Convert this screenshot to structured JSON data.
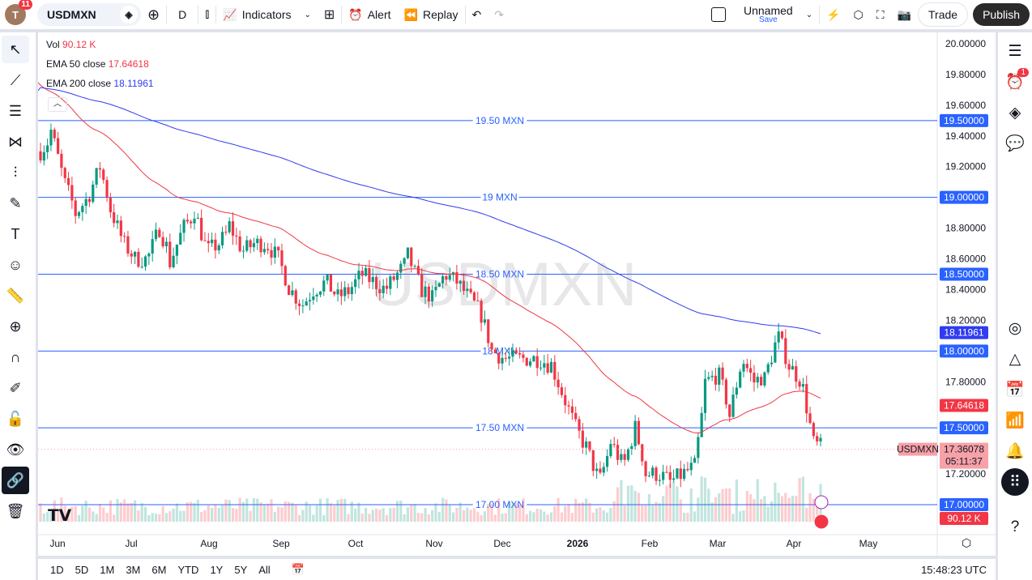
{
  "toolbar": {
    "avatar_letter": "T",
    "notif": "11",
    "symbol": "USDMXN",
    "interval": "D",
    "indicators": "Indicators",
    "alert": "Alert",
    "replay": "Replay",
    "layout_name": "Unnamed",
    "save": "Save",
    "trade": "Trade",
    "publish": "Publish"
  },
  "legend": {
    "vol_label": "Vol",
    "vol_value": "90.12 K",
    "ema50_label": "EMA 50 close",
    "ema50_value": "17.64618",
    "ema200_label": "EMA 200 close",
    "ema200_value": "18.11961"
  },
  "watermark": "USDMXN",
  "price_axis": [
    "20.00000",
    "19.80000",
    "19.60000",
    "19.40000",
    "19.20000",
    "18.80000",
    "18.60000",
    "18.40000",
    "18.20000",
    "17.80000",
    "17.20000"
  ],
  "hlines": [
    {
      "label": "19.50 MXN",
      "price": 19.5,
      "tag": "19.50000"
    },
    {
      "label": "19 MXN",
      "price": 19.0,
      "tag": "19.00000"
    },
    {
      "label": "18.50 MXN",
      "price": 18.5,
      "tag": "18.50000"
    },
    {
      "label": "18 MXN",
      "price": 18.0,
      "tag": "18.00000"
    },
    {
      "label": "17.50 MXN",
      "price": 17.5,
      "tag": "17.50000"
    },
    {
      "label": "17.00 MXN",
      "price": 17.0,
      "tag": "17.00000"
    }
  ],
  "tags": {
    "ema200": "18.11961",
    "ema50": "17.64618",
    "symbol": "USDMXN",
    "last": "17.36078",
    "countdown": "05:11:37",
    "vol": "90.12 K"
  },
  "time_axis": [
    "Jun",
    "Jul",
    "Aug",
    "Sep",
    "Oct",
    "Nov",
    "Dec",
    "2026",
    "Feb",
    "Mar",
    "Apr",
    "May"
  ],
  "ranges": [
    "1D",
    "5D",
    "1M",
    "3M",
    "6M",
    "YTD",
    "1Y",
    "5Y",
    "All"
  ],
  "clock": "15:48:23 UTC",
  "alerts_badge": "1",
  "colors": {
    "up": "#089981",
    "down": "#f23645",
    "ema50": "#f23645",
    "ema200": "#2f3cf0",
    "hline": "#2962ff"
  },
  "chart_data": {
    "type": "candlestick",
    "symbol": "USDMXN",
    "weekly_closes": [
      19.3,
      19.4,
      19.1,
      18.9,
      19.0,
      19.2,
      18.9,
      18.7,
      18.6,
      18.6,
      18.8,
      18.6,
      18.8,
      18.9,
      18.65,
      18.7,
      18.8,
      18.65,
      18.7,
      18.7,
      18.6,
      18.4,
      18.3,
      18.4,
      18.45,
      18.35,
      18.4,
      18.5,
      18.45,
      18.4,
      18.5,
      18.6,
      18.4,
      18.35,
      18.5,
      18.45,
      18.35,
      18.25,
      18.0,
      17.95,
      17.95,
      17.95,
      17.95,
      17.9,
      17.7,
      17.5,
      17.35,
      17.15,
      17.4,
      17.25,
      17.5,
      17.2,
      17.2,
      17.15,
      17.2,
      17.25,
      17.8,
      17.85,
      17.6,
      17.95,
      17.8,
      17.85,
      18.1,
      17.9,
      17.8,
      17.4,
      17.36
    ],
    "last": 17.36078,
    "ema50": 17.64618,
    "ema200": 18.11961,
    "ylim": [
      16.9,
      20.05
    ]
  }
}
